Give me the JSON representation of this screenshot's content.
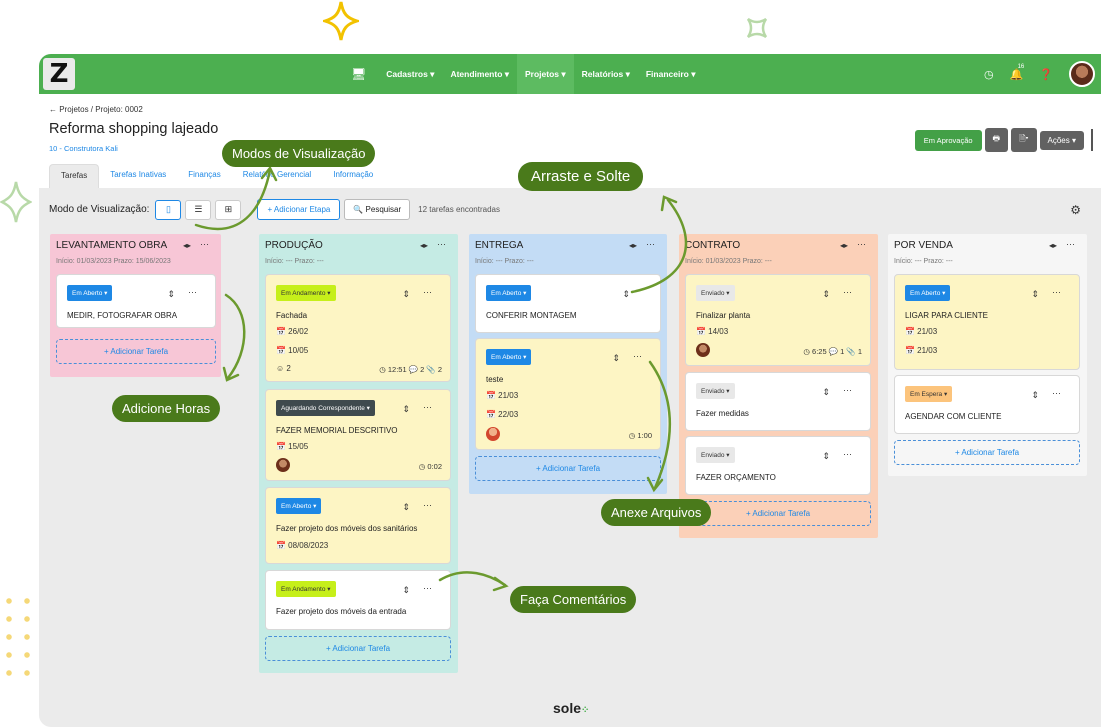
{
  "colors": {
    "topbar": "#4caf50",
    "accent": "#1e88e5",
    "callout": "#4a7a1b",
    "primary_action": "#43a047"
  },
  "topbar": {
    "logo": "Z",
    "nav": [
      "Cadastros ▾",
      "Atendimento ▾",
      "Projetos ▾",
      "Relatórios ▾",
      "Financeiro ▾"
    ],
    "notifications_count": "16",
    "icons": [
      "monitor-icon",
      "clock-icon",
      "bell-icon",
      "help-icon"
    ]
  },
  "header": {
    "breadcrumb": "← Projetos / Projeto: 0002",
    "title": "Reforma shopping lajeado",
    "client": "10 - Construtora Kali",
    "approve_button": "Em Aprovação",
    "print_icon": "🖶",
    "doc_button": "🗎▾",
    "actions_button": "Ações ▾",
    "tabs": [
      "Tarefas",
      "Tarefas Inativas",
      "Finanças",
      "Relatório Gerencial",
      "Informação"
    ]
  },
  "toolbar": {
    "view_label": "Modo de Visualização:",
    "view_icons": [
      "▯",
      "☰",
      "⊞"
    ],
    "add_stage": "+   Adicionar Etapa",
    "search": "🔍 Pesquisar",
    "found": "12 tarefas encontradas"
  },
  "columns": [
    {
      "title": "LEVANTAMENTO OBRA",
      "dates": "Início: 01/03/2023   Prazo: 15/06/2023",
      "cards": [
        {
          "badge": "Em Aberto ▾",
          "title": "MEDIR, FOTOGRAFAR OBRA"
        }
      ],
      "add": "+   Adicionar Tarefa"
    },
    {
      "title": "PRODUÇÃO",
      "dates": "Início: ---   Prazo: ---",
      "cards": [
        {
          "badge": "Em Andamento ▾",
          "title": "Fachada",
          "date1": "📅 26/02",
          "date2": "📅 10/05",
          "count": "2",
          "meta": "◷ 12:51  💬 2  📎 2"
        },
        {
          "badge": "Aguardando Correspondente ▾",
          "title": "FAZER MEMORIAL DESCRITIVO",
          "date1": "📅 15/05",
          "meta": "◷ 0:02"
        },
        {
          "badge": "Em Aberto ▾",
          "title": "Fazer projeto dos móveis dos sanitários",
          "date1": "📅 08/08/2023"
        },
        {
          "badge": "Em Andamento ▾",
          "title": "Fazer projeto dos móveis da entrada"
        }
      ],
      "add": "+   Adicionar Tarefa"
    },
    {
      "title": "ENTREGA",
      "dates": "Início: ---   Prazo: ---",
      "cards": [
        {
          "badge": "Em Aberto ▾",
          "title": "CONFERIR MONTAGEM"
        },
        {
          "badge": "Em Aberto ▾",
          "title": "teste",
          "date1": "📅 21/03",
          "date2": "📅 22/03",
          "meta": "◷ 1:00"
        }
      ],
      "add": "+   Adicionar Tarefa"
    },
    {
      "title": "CONTRATO",
      "dates": "Início: 01/03/2023   Prazo: ---",
      "cards": [
        {
          "badge": "Enviado ▾",
          "title": "Finalizar planta",
          "date1": "📅 14/03",
          "meta": "◷ 6:25  💬 1  📎 1"
        },
        {
          "badge": "Enviado ▾",
          "title": "Fazer medidas"
        },
        {
          "badge": "Enviado ▾",
          "title": "FAZER ORÇAMENTO"
        }
      ],
      "add": "+   Adicionar Tarefa"
    },
    {
      "title": "POR VENDA",
      "dates": "Início: ---   Prazo: ---",
      "cards": [
        {
          "badge": "Em Aberto ▾",
          "title": "LIGAR PARA CLIENTE",
          "date1": "📅 21/03",
          "date2": "📅 21/03"
        },
        {
          "badge": "Em Espera ▾",
          "title": "AGENDAR COM CLIENTE"
        }
      ],
      "add": "+   Adicionar Tarefa"
    }
  ],
  "callouts": {
    "views": "Modos de Visualização",
    "drag": "Arraste e Solte",
    "hours": "Adicione Horas",
    "files": "Anexe Arquivos",
    "comments": "Faça Comentários"
  },
  "footer": {
    "brand": "sole"
  }
}
